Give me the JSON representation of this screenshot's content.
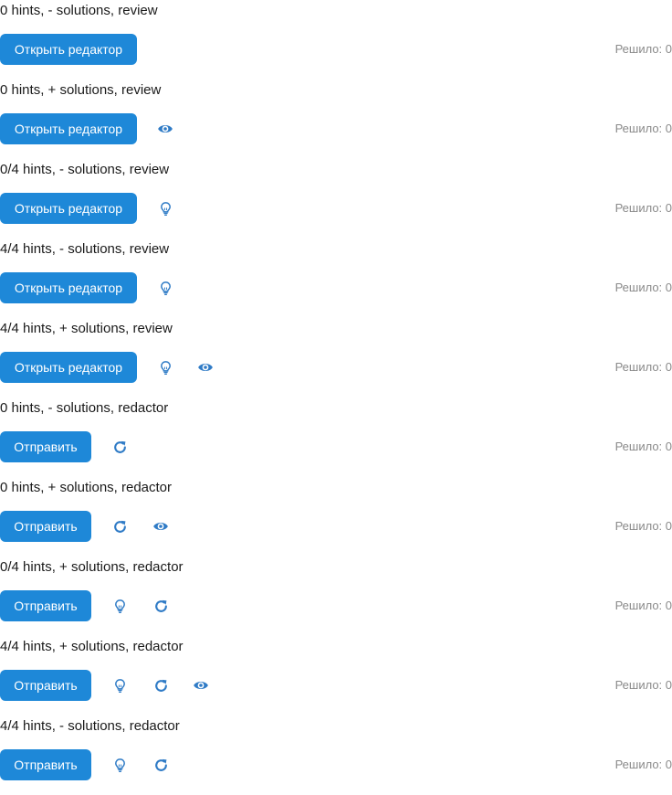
{
  "colors": {
    "primary": "#1e88d8",
    "icon": "#2f7bc6",
    "muted": "#8a8a8a"
  },
  "icons": {
    "hint": "lightbulb-icon",
    "reset": "refresh-icon",
    "solutions": "eye-icon"
  },
  "cases": [
    {
      "title": "0 hints, - solutions, review",
      "button": "Открыть редактор",
      "solved": "Решило: 0"
    },
    {
      "title": "0 hints, + solutions, review",
      "button": "Открыть редактор",
      "solved": "Решило: 0"
    },
    {
      "title": "0/4 hints, - solutions, review",
      "button": "Открыть редактор",
      "solved": "Решило: 0"
    },
    {
      "title": "4/4 hints, - solutions, review",
      "button": "Открыть редактор",
      "solved": "Решило: 0"
    },
    {
      "title": "4/4 hints, + solutions, review",
      "button": "Открыть редактор",
      "solved": "Решило: 0"
    },
    {
      "title": "0 hints, - solutions, redactor",
      "button": "Отправить",
      "solved": "Решило: 0"
    },
    {
      "title": "0 hints, + solutions, redactor",
      "button": "Отправить",
      "solved": "Решило: 0"
    },
    {
      "title": "0/4 hints, + solutions, redactor",
      "button": "Отправить",
      "solved": "Решило: 0"
    },
    {
      "title": "4/4 hints, + solutions, redactor",
      "button": "Отправить",
      "solved": "Решило: 0"
    },
    {
      "title": "4/4 hints, - solutions, redactor",
      "button": "Отправить",
      "solved": "Решило: 0"
    }
  ]
}
